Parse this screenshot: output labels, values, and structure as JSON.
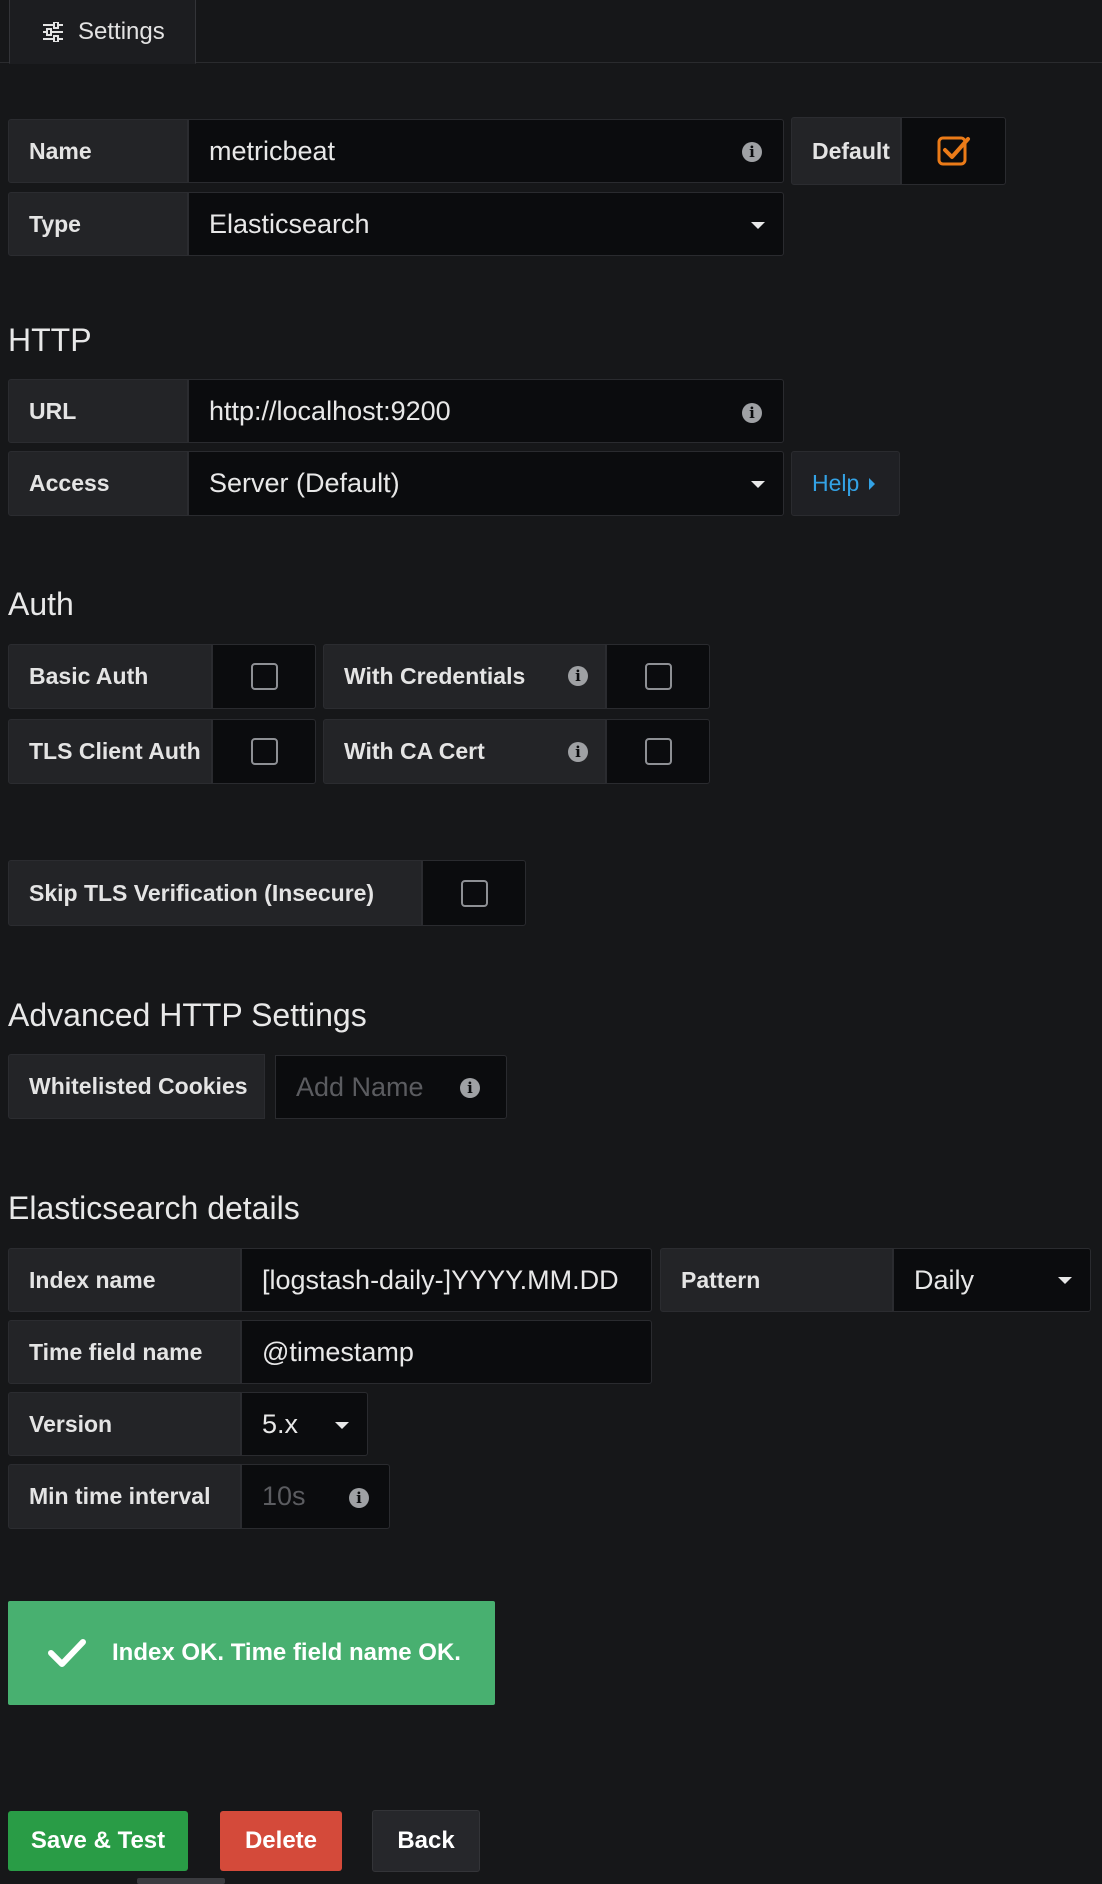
{
  "tab": {
    "label": "Settings",
    "icon": "sliders-icon"
  },
  "basic": {
    "name_label": "Name",
    "name_value": "metricbeat",
    "default_label": "Default",
    "default_checked": true,
    "type_label": "Type",
    "type_value": "Elasticsearch"
  },
  "http": {
    "title": "HTTP",
    "url_label": "URL",
    "url_value": "http://localhost:9200",
    "access_label": "Access",
    "access_value": "Server (Default)",
    "help_label": "Help"
  },
  "auth": {
    "title": "Auth",
    "basic_auth_label": "Basic Auth",
    "with_credentials_label": "With Credentials",
    "tls_client_auth_label": "TLS Client Auth",
    "with_ca_cert_label": "With CA Cert",
    "skip_tls_label": "Skip TLS Verification (Insecure)"
  },
  "advanced": {
    "title": "Advanced HTTP Settings",
    "cookies_label": "Whitelisted Cookies",
    "cookies_placeholder": "Add Name"
  },
  "es": {
    "title": "Elasticsearch details",
    "index_label": "Index name",
    "index_value": "[logstash-daily-]YYYY.MM.DD",
    "pattern_label": "Pattern",
    "pattern_value": "Daily",
    "time_field_label": "Time field name",
    "time_field_value": "@timestamp",
    "version_label": "Version",
    "version_value": "5.x",
    "min_interval_label": "Min time interval",
    "min_interval_placeholder": "10s"
  },
  "alert": {
    "message": "Index OK. Time field name OK."
  },
  "buttons": {
    "save": "Save & Test",
    "delete": "Delete",
    "back": "Back"
  },
  "colors": {
    "background": "#161719",
    "accent_orange": "#eb7b18",
    "success": "#48b070",
    "save": "#299c46",
    "delete": "#d44a3a",
    "link": "#33a2e5"
  }
}
